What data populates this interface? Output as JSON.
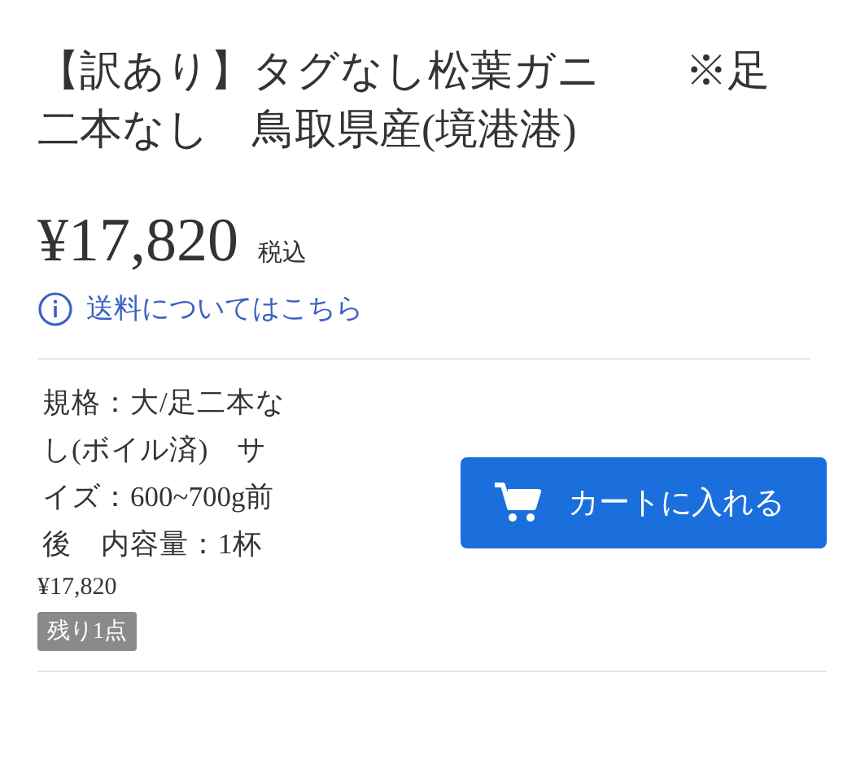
{
  "product": {
    "title": "【訳あり】タグなし松葉ガニ　　※足二本なし　鳥取県産(境港港)",
    "price": "¥17,820",
    "tax_note": "税込",
    "shipping_link": "送料についてはこちら"
  },
  "variant": {
    "description": "規格：大/足二本なし(ボイル済)　サイズ：600~700g前後　内容量：1杯",
    "price": "¥17,820",
    "stock_badge": "残り1点",
    "add_to_cart": "カートに入れる"
  }
}
